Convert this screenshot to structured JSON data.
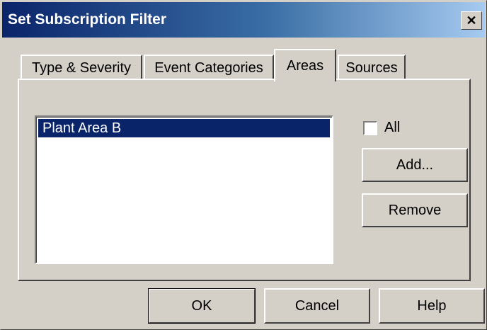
{
  "window": {
    "title": "Set Subscription Filter",
    "close_glyph": "✕"
  },
  "tabs": [
    {
      "label": "Type & Severity",
      "active": false
    },
    {
      "label": "Event Categories",
      "active": false
    },
    {
      "label": "Areas",
      "active": true
    },
    {
      "label": "Sources",
      "active": false
    }
  ],
  "areas": {
    "list_items": [
      "Plant Area B"
    ],
    "selected_index": 0,
    "all_checkbox": {
      "label": "All",
      "checked": false
    },
    "add_label": "Add...",
    "remove_label": "Remove"
  },
  "footer": {
    "ok_label": "OK",
    "cancel_label": "Cancel",
    "help_label": "Help"
  },
  "colors": {
    "face": "#d4d0c8",
    "title_start": "#0a246a",
    "title_end": "#a6caf0",
    "selection": "#0a246a"
  }
}
